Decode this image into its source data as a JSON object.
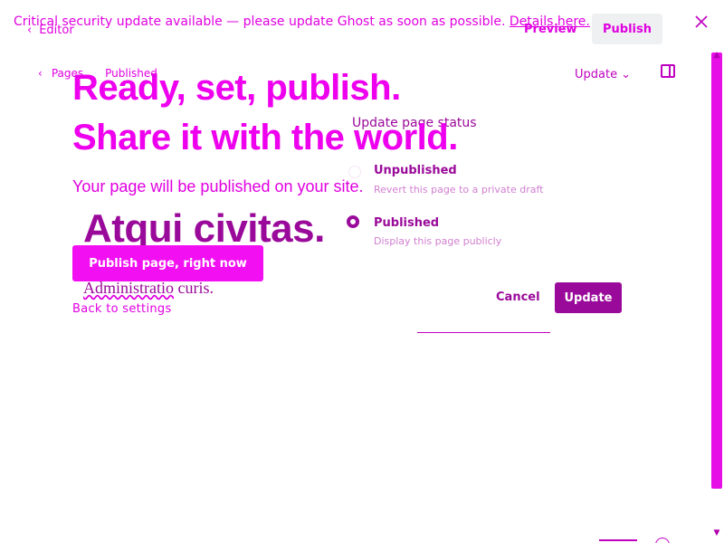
{
  "banner": {
    "text": "Critical security update available — please update Ghost as soon as possible.",
    "link": "Details here."
  },
  "topbar": {
    "back_label": "Editor",
    "preview_label": "Preview",
    "publish_label": "Publish"
  },
  "breadcrumb": {
    "parent": "Pages",
    "state": "Published"
  },
  "settings_bar": {
    "update_label": "Update"
  },
  "publish_flow": {
    "headline_line1": "Ready, set, publish.",
    "headline_line2": "Share it with the world.",
    "subline": "Your page will be published on your site.",
    "publish_now_label": "Publish page, right now",
    "back_to_settings": "Back to settings"
  },
  "document": {
    "title": "Atqui civitas.",
    "body_word": "Administratio",
    "body_rest": " curis."
  },
  "status_popup": {
    "heading": "Update page status",
    "options": [
      {
        "title": "Unpublished",
        "description": "Revert this page to a private draft",
        "selected": false
      },
      {
        "title": "Published",
        "description": "Display this page publicly",
        "selected": true
      }
    ],
    "cancel_label": "Cancel",
    "update_label": "Update"
  },
  "colors": {
    "accent": "#e60fe6",
    "dark_accent": "#9a0a9a",
    "button_gray": "#eef0f2"
  }
}
